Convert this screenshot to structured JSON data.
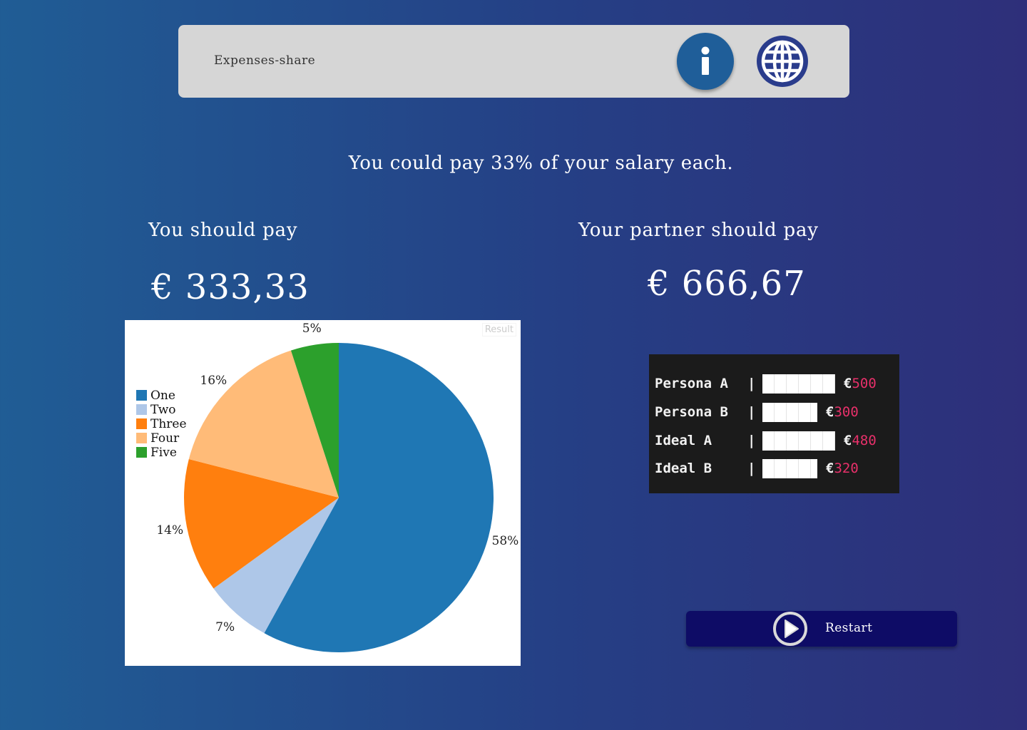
{
  "header": {
    "title": "Expenses-share",
    "info_icon": "info-icon",
    "language_icon": "globe-icon",
    "bar_color": "#d6d6d6",
    "info_color": "#1f5e99",
    "globe_color": "#2a3c8c"
  },
  "summary": {
    "headline": "You could pay 33% of your salary each.",
    "you_label": "You should pay",
    "you_amount": "€ 333,33",
    "partner_label": "Your partner should pay",
    "partner_amount": "€ 666,67"
  },
  "chart": {
    "result_tag": "Result"
  },
  "chart_data": {
    "type": "pie",
    "categories": [
      "One",
      "Two",
      "Three",
      "Four",
      "Five"
    ],
    "values": [
      58,
      7,
      14,
      16,
      5
    ],
    "labels": [
      "58%",
      "7%",
      "14%",
      "16%",
      "5%"
    ],
    "colors": [
      "#1f77b4",
      "#aec7e8",
      "#ff7f0e",
      "#ffbb78",
      "#2ca02c"
    ],
    "legend_position": "left"
  },
  "terminal": {
    "rows": [
      {
        "name": "Persona A",
        "sep": "|",
        "currency": "€",
        "value": "500",
        "bar_fraction": 1.0
      },
      {
        "name": "Persona B",
        "sep": "|",
        "currency": "€",
        "value": "300",
        "bar_fraction": 0.75
      },
      {
        "name": "Ideal A",
        "sep": "|",
        "currency": "€",
        "value": "480",
        "bar_fraction": 1.0
      },
      {
        "name": "Ideal B",
        "sep": "|",
        "currency": "€",
        "value": "320",
        "bar_fraction": 0.75
      }
    ],
    "value_color": "#e8306a"
  },
  "restart": {
    "label": "Restart",
    "icon": "play-icon",
    "button_color": "#0e0c66"
  }
}
